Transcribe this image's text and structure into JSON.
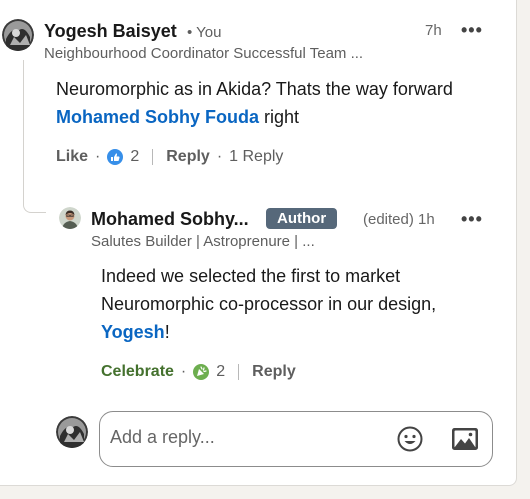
{
  "comment": {
    "author": "Yogesh Baisyet",
    "you_tag": "• You",
    "headline": "Neighbourhood Coordinator Successful Team ...",
    "time": "7h",
    "more": "•••",
    "text_before": "Neuromorphic as in Akida? Thats the way forward ",
    "mention": "Mohamed Sobhy Fouda",
    "text_after": " right",
    "like_label": "Like",
    "dot": "·",
    "reaction_count": "2",
    "reply_label": "Reply",
    "replies_count": "1 Reply"
  },
  "reply": {
    "author": "Mohamed Sobhy...",
    "badge": "Author",
    "edited_time": "(edited) 1h",
    "more": "•••",
    "headline": "Salutes Builder | Astroprenure | ...",
    "text_before": "Indeed we selected the first to market Neuromorphic co-processor in our design, ",
    "mention": "Yogesh",
    "text_after": "!",
    "celebrate_label": "Celebrate",
    "dot": "·",
    "reaction_count": "2",
    "reply_label": "Reply"
  },
  "reply_input": {
    "placeholder": "Add a reply...",
    "emoji_icon": "emoji-icon",
    "image_icon": "image-icon"
  },
  "colors": {
    "link": "#0a66c2",
    "celebrate": "#44712e",
    "badge": "#56687a"
  }
}
